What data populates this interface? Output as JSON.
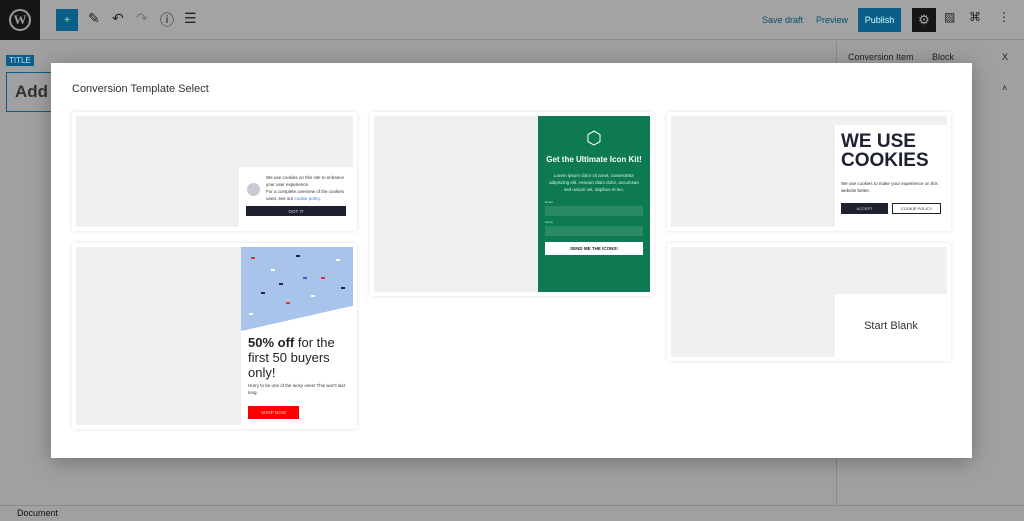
{
  "toolbar": {
    "save_draft": "Save draft",
    "preview": "Preview",
    "publish": "Publish"
  },
  "editor": {
    "title_badge": "TITLE",
    "title_placeholder": "Add"
  },
  "sidebar": {
    "tabs": [
      "Conversion Item",
      "Block"
    ],
    "close": "X"
  },
  "bottom": {
    "breadcrumb": "Document"
  },
  "modal": {
    "title": "Conversion Template Select",
    "templates": {
      "cookie_bar": {
        "text1": "We use cookies on this site to enhance your user experience.",
        "text2": "For a complete overview of the cookies used, see our",
        "link": "cookie policy.",
        "button": "GOT IT"
      },
      "discount": {
        "headline_bold": "50% off",
        "headline_rest": " for the first 50 buyers only!",
        "body": "Hurry to be one of the lucky ones! This won't last long.",
        "button": "SHOP NOW"
      },
      "icon_kit": {
        "headline": "Get the Ultimate Icon Kit!",
        "body": "Lorem ipsum dolor sit amet, consectetur adipiscing elit. Aenean diam dolor, accumsan sed rutrum vel, dapibus et leo.",
        "field1": "Email",
        "field2": "Name",
        "button": "SEND ME THE ICONS!",
        "color": "#0e7a52"
      },
      "we_use_cookies": {
        "headline": "WE USE COOKIES",
        "body": "We use cookies to make your experience on this website better.",
        "accept": "ACCEPT",
        "policy": "COOKIE POLICY"
      },
      "blank": {
        "label": "Start Blank"
      }
    }
  },
  "colors": {
    "accent": "#0a5f8a",
    "dark": "#1d2130",
    "sale": "#ff0000"
  }
}
